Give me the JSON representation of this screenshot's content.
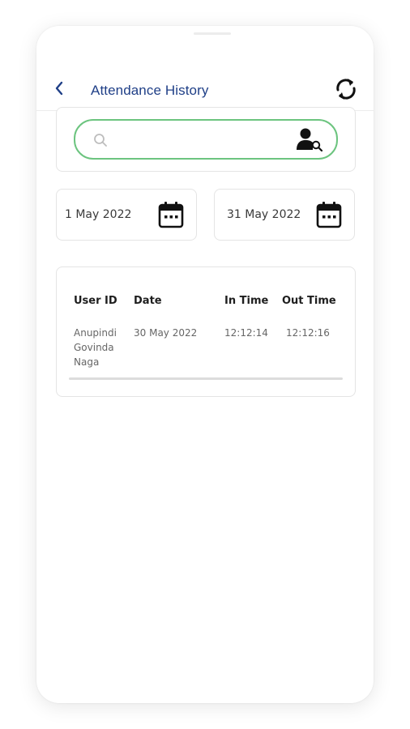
{
  "header": {
    "title": "Attendance History",
    "back_icon": "chevron-left-icon",
    "refresh_icon": "sync-icon"
  },
  "search": {
    "placeholder": "",
    "value": "",
    "search_icon": "search-icon",
    "user_search_icon": "user-search-icon"
  },
  "date_range": {
    "start": "1 May 2022",
    "end": "31 May 2022",
    "icon": "calendar-icon"
  },
  "table": {
    "headers": {
      "user_id": "User ID",
      "date": "Date",
      "in_time": "In Time",
      "out_time": "Out Time"
    },
    "rows": [
      {
        "user_id_lines": [
          "Anupindi",
          "Govinda",
          "Naga"
        ],
        "date": "30 May 2022",
        "in_time": "12:12:14",
        "out_time": "12:12:16"
      }
    ]
  },
  "colors": {
    "title": "#1f3f87",
    "search_border": "#6cc47f",
    "card_border": "#e4e4e4"
  }
}
